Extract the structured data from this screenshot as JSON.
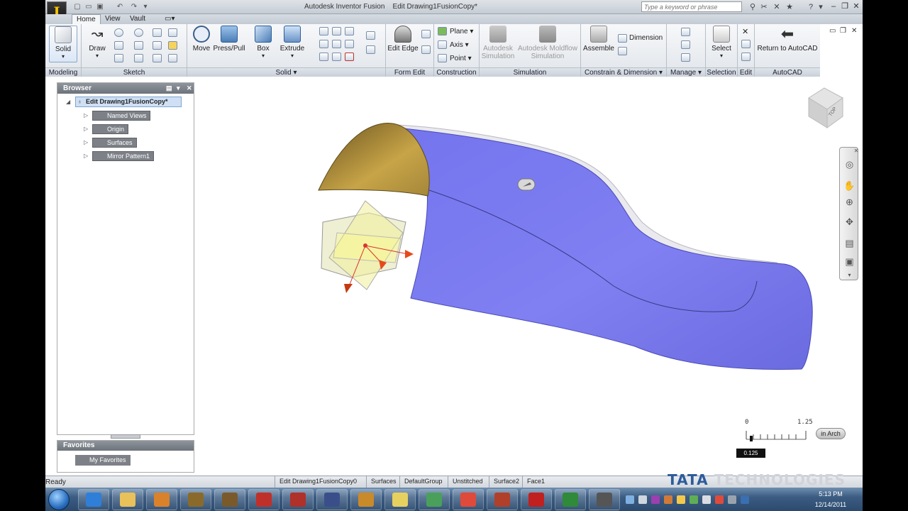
{
  "app": {
    "logo": "I",
    "window_title": "Autodesk Inventor Fusion",
    "document_title": "Edit Drawing1FusionCopy*",
    "search_placeholder": "Type a keyword or phrase"
  },
  "tabs": [
    "Home",
    "View",
    "Vault"
  ],
  "ribbon": {
    "modeling": {
      "label": "Modeling",
      "solid": "Solid"
    },
    "sketch": {
      "label": "Sketch",
      "draw": "Draw"
    },
    "solid_panel": {
      "label": "Solid",
      "move": "Move",
      "presspull": "Press/Pull",
      "box": "Box",
      "extrude": "Extrude"
    },
    "form_edit": {
      "label": "Form Edit",
      "edit_edge": "Edit Edge"
    },
    "construction": {
      "label": "Construction",
      "plane": "Plane",
      "axis": "Axis",
      "point": "Point"
    },
    "simulation": {
      "label": "Simulation",
      "autodesk_sim_1": "Autodesk",
      "autodesk_sim_2": "Simulation",
      "moldflow_1": "Autodesk Moldflow",
      "moldflow_2": "Simulation"
    },
    "constrain": {
      "label": "Constrain & Dimension",
      "assemble": "Assemble",
      "dimension": "Dimension"
    },
    "manage": {
      "label": "Manage"
    },
    "selection": {
      "label": "Selection",
      "select": "Select"
    },
    "edit": {
      "label": "Edit"
    },
    "autocad": {
      "label": "AutoCAD",
      "return": "Return to AutoCAD"
    }
  },
  "browser": {
    "title": "Browser",
    "root": "Edit Drawing1FusionCopy*",
    "items": [
      "Named Views",
      "Origin",
      "Surfaces",
      "Mirror Pattern1"
    ]
  },
  "favorites": {
    "title": "Favorites",
    "items": [
      "My Favorites"
    ]
  },
  "viewcube": {
    "face": "TOP"
  },
  "scale": {
    "start": "0",
    "end": "1.25",
    "value": "0.125",
    "units": "in Arch"
  },
  "status": {
    "ready": "Ready",
    "cells": [
      "Edit Drawing1FusionCopy0",
      "Surfaces",
      "DefaultGroup",
      "Unstitched",
      "Surface2",
      "Face1"
    ]
  },
  "watermark": {
    "brand": "TATA",
    "rest": "TECHNOLOGIES"
  },
  "taskbar": {
    "time": "5:13 PM",
    "date": "12/14/2011",
    "app_colors": [
      "#2f7fd8",
      "#e8c15a",
      "#d9822b",
      "#8a6a2a",
      "#7a5a2a",
      "#c0302a",
      "#b0302a",
      "#3a4f8a",
      "#c98a2a",
      "#e6d060",
      "#4aa05a",
      "#e04a3a",
      "#b0402a",
      "#c02020",
      "#2f8a3a",
      "#555555"
    ]
  },
  "colors": {
    "surface": "#7b7bf0",
    "cap": "#b0903a",
    "accent": "#2d5c9a"
  }
}
